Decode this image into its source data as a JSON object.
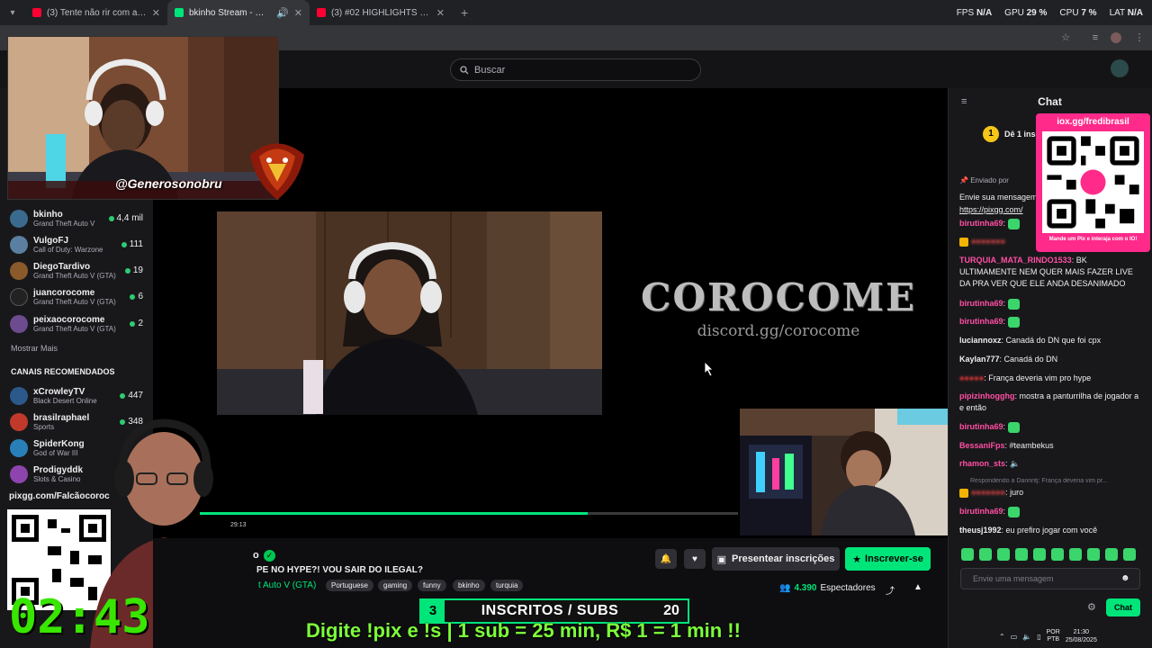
{
  "browser": {
    "tabs": [
      {
        "title": "(3) Tente não rir com a CoroCome",
        "color": "#ff0033",
        "active": false
      },
      {
        "title": "bkinho Stream - Watch Live",
        "color": "#00e57a",
        "active": true
      },
      {
        "title": "(3) #02 HIGHLIGHTS NAIPEX TE",
        "color": "#ff0033",
        "active": false
      }
    ],
    "perf": {
      "fps_label": "FPS",
      "fps_value": "N/A",
      "gpu_label": "GPU",
      "gpu_value": "29 %",
      "cpu_label": "CPU",
      "cpu_value": "7 %",
      "lat_label": "LAT",
      "lat_value": "N/A"
    }
  },
  "header": {
    "search_placeholder": "Buscar"
  },
  "sidebar": {
    "followed": [
      {
        "name": "bkinho",
        "game": "Grand Theft Auto V",
        "viewers": "4,4 mil",
        "color": "#3a6b8f"
      },
      {
        "name": "VulgoFJ",
        "game": "Call of Duty: Warzone",
        "viewers": "111",
        "color": "#5a7fa0"
      },
      {
        "name": "DiegoTardivo",
        "game": "Grand Theft Auto V (GTA)",
        "viewers": "19",
        "color": "#8a5a2b"
      },
      {
        "name": "juancorocome",
        "game": "Grand Theft Auto V (GTA)",
        "viewers": "6",
        "color": "#222"
      },
      {
        "name": "peixaocorocome",
        "game": "Grand Theft Auto V (GTA)",
        "viewers": "2",
        "color": "#6d4b8f"
      }
    ],
    "show_more": "Mostrar Mais",
    "recommended_header": "CANAIS RECOMENDADOS",
    "recommended": [
      {
        "name": "xCrowleyTV",
        "game": "Black Desert Online",
        "viewers": "447",
        "color": "#2b5a8a"
      },
      {
        "name": "brasilraphael",
        "game": "Sports",
        "viewers": "348",
        "color": "#c0392b"
      },
      {
        "name": "SpiderKong",
        "game": "God of War III",
        "viewers": "",
        "color": "#2980b9"
      },
      {
        "name": "Prodigyddk",
        "game": "Slots & Casino",
        "viewers": "",
        "color": "#8e44ad"
      }
    ]
  },
  "player": {
    "brand_title": "COROCOME",
    "brand_sub": "discord.gg/corocome",
    "progress": 0.72,
    "time": "29:13"
  },
  "overlays": {
    "handle": "@Generosonobru",
    "pix_link": "pixgg.com/Falcãocoroc",
    "timer": "02:43:1",
    "subgoal_left": "3",
    "subgoal_label": "INSCRITOS / SUBS",
    "subgoal_right": "20",
    "ticker": "Digite !pix e !s | 1 sub = 25 min, R$ 1 = 1 min !!"
  },
  "stream": {
    "name_fragment": "o",
    "title": "PE NO HYPE?! VOU SAIR DO ILEGAL?",
    "game": "t Auto V (GTA)",
    "tags": [
      "Portuguese",
      "gaming",
      "funny",
      "bkinho",
      "turquia"
    ],
    "gift_label": "Presentear inscrições",
    "subscribe_label": "Inscrever-se",
    "viewers": "4.390",
    "viewers_label": "Espectadores"
  },
  "chat": {
    "title": "Chat",
    "gift_badge": "1",
    "gift_text": "Dê 1 insc",
    "pinned_by": "Enviado por",
    "pinned_text": "Envie sua mensagem",
    "pinned_link": "https://pixgg.com/",
    "messages": [
      {
        "user": "birutinha69",
        "color": "#ff4fa3",
        "text": "",
        "emote": true,
        "sub": false
      },
      {
        "user": "",
        "color": "#ff4f4f",
        "text": "",
        "emote": false,
        "sub": true
      },
      {
        "user": "TURQUIA_MATA_RINDO1533",
        "color": "#ff4fa3",
        "text": "BK ULTIMAMENTE NEM QUER MAIS FAZER LIVE DA PRA VER QUE ELE ANDA DESANIMADO",
        "emote": false,
        "sub": false
      },
      {
        "user": "birutinha69",
        "color": "#ff4fa3",
        "text": "",
        "emote": true,
        "sub": false
      },
      {
        "user": "birutinha69",
        "color": "#ff4fa3",
        "text": "",
        "emote": true,
        "sub": false
      },
      {
        "user": "luciannoxz",
        "color": "#efeff1",
        "text": "Canadá do DN que foi cpx",
        "emote": false,
        "sub": false
      },
      {
        "user": "Kaylan777",
        "color": "#efeff1",
        "text": "Canadá do DN",
        "emote": false,
        "sub": false
      },
      {
        "user": "",
        "color": "#ff3b3b",
        "text": "França deveria vim pro hype",
        "emote": false,
        "sub": false
      },
      {
        "user": "pipizinhogghg",
        "color": "#ff4fa3",
        "text": "mostra a panturrilha de jogador a e então",
        "emote": false,
        "sub": false
      },
      {
        "user": "birutinha69",
        "color": "#ff4fa3",
        "text": "",
        "emote": true,
        "sub": false
      },
      {
        "user": "BessaniFps",
        "color": "#ff4fa3",
        "text": "#teambekus",
        "emote": false,
        "sub": false
      },
      {
        "user": "rhamon_sts",
        "color": "#ff4fa3",
        "text": "",
        "emote": false,
        "sub": false
      },
      {
        "user": "",
        "color": "#ff4f4f",
        "text": "juro",
        "emote": false,
        "sub": true
      },
      {
        "user": "birutinha69",
        "color": "#ff4fa3",
        "text": "",
        "emote": true,
        "sub": false
      },
      {
        "user": "theusj1992",
        "color": "#efeff1",
        "text": "eu prefiro jogar com você",
        "emote": false,
        "sub": false
      }
    ],
    "reply_note": "Respondendo a Dannntj: França deveria vim pr...",
    "input_placeholder": "Envie uma mensagem",
    "send_label": "Chat"
  },
  "pix_card": {
    "header": "iox.gg/fredibrasil",
    "footer": "Mande um Pix e interaja com o IO!"
  },
  "tray": {
    "lang1": "POR",
    "lang2": "PTB",
    "time": "21:30",
    "date": "25/08/2025"
  }
}
